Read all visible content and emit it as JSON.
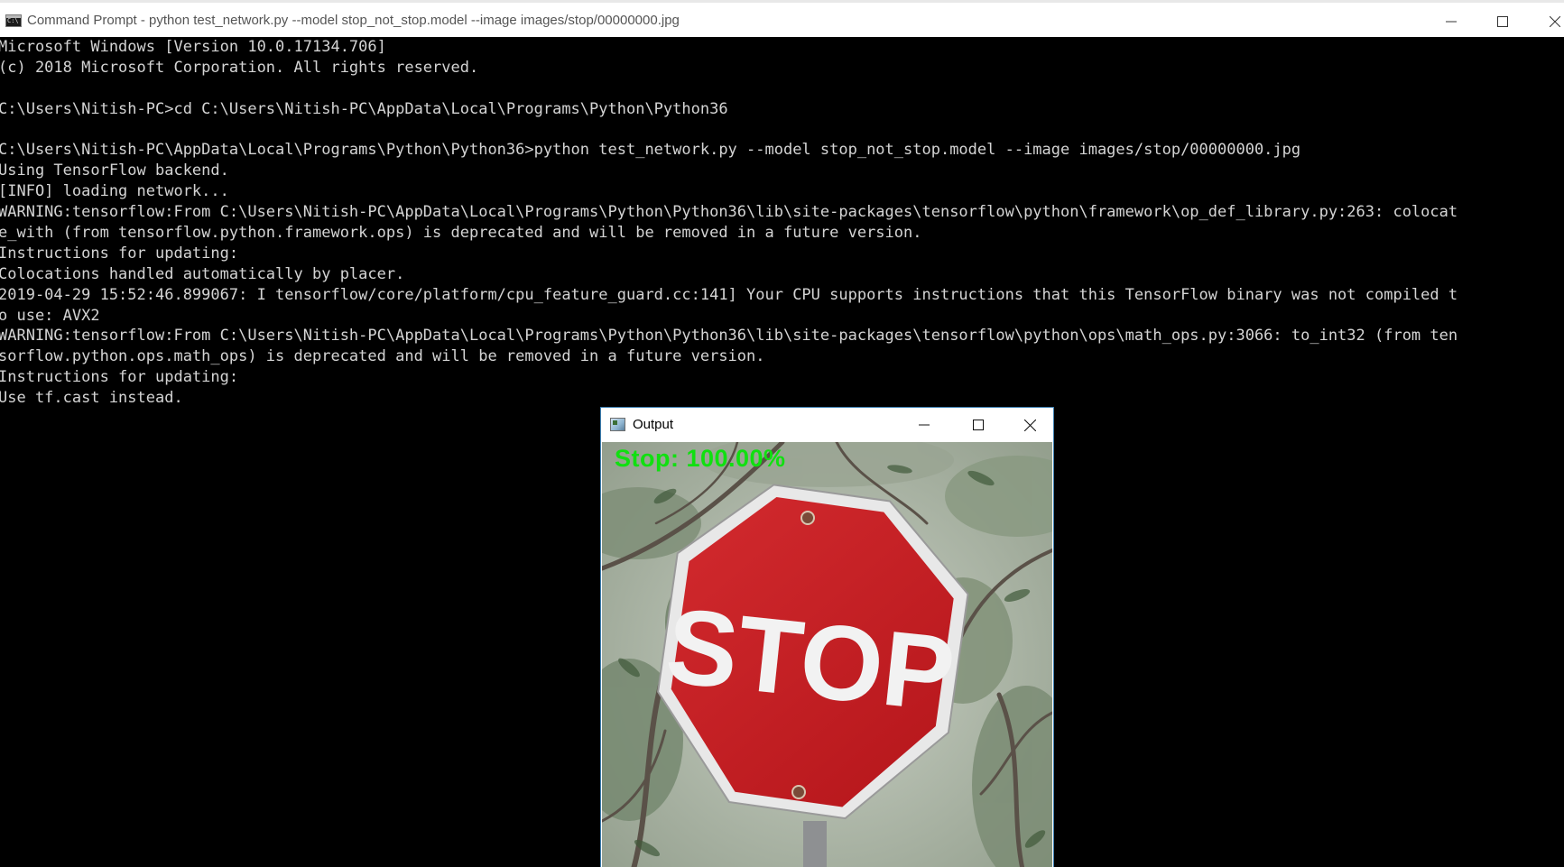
{
  "cmd_window": {
    "title": "Command Prompt - python  test_network.py --model stop_not_stop.model --image images/stop/00000000.jpg",
    "icon": "console-icon",
    "controls": [
      "minimize-icon",
      "maximize-icon",
      "close-icon"
    ]
  },
  "console": {
    "text_color": "#d4d4d4",
    "background": "#000000",
    "lines": [
      "Microsoft Windows [Version 10.0.17134.706]",
      "(c) 2018 Microsoft Corporation. All rights reserved.",
      "",
      "C:\\Users\\Nitish-PC>cd C:\\Users\\Nitish-PC\\AppData\\Local\\Programs\\Python\\Python36",
      "",
      "C:\\Users\\Nitish-PC\\AppData\\Local\\Programs\\Python\\Python36>python test_network.py --model stop_not_stop.model --image images/stop/00000000.jpg",
      "Using TensorFlow backend.",
      "[INFO] loading network...",
      "WARNING:tensorflow:From C:\\Users\\Nitish-PC\\AppData\\Local\\Programs\\Python\\Python36\\lib\\site-packages\\tensorflow\\python\\framework\\op_def_library.py:263: colocat",
      "e_with (from tensorflow.python.framework.ops) is deprecated and will be removed in a future version.",
      "Instructions for updating:",
      "Colocations handled automatically by placer.",
      "2019-04-29 15:52:46.899067: I tensorflow/core/platform/cpu_feature_guard.cc:141] Your CPU supports instructions that this TensorFlow binary was not compiled t",
      "o use: AVX2",
      "WARNING:tensorflow:From C:\\Users\\Nitish-PC\\AppData\\Local\\Programs\\Python\\Python36\\lib\\site-packages\\tensorflow\\python\\ops\\math_ops.py:3066: to_int32 (from ten",
      "sorflow.python.ops.math_ops) is deprecated and will be removed in a future version.",
      "Instructions for updating:",
      "Use tf.cast instead."
    ]
  },
  "output_window": {
    "title": "Output",
    "icon": "image-window-icon",
    "controls": [
      "minimize-icon",
      "maximize-icon",
      "close-icon"
    ],
    "prediction_label": "Stop: 100.00%",
    "prediction_color": "#10e010",
    "image": {
      "subject": "stop-sign-photo",
      "sign_text": "STOP",
      "sign_color": "#c41a1f"
    }
  }
}
